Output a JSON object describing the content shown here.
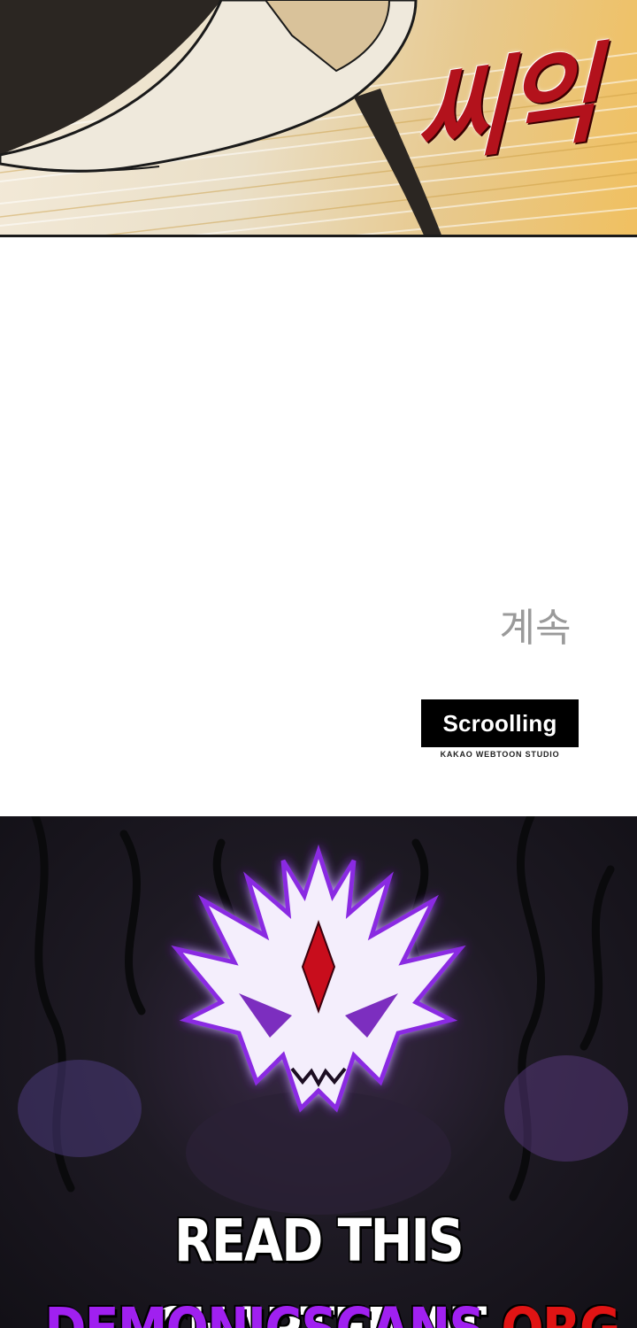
{
  "panel": {
    "sound_effect": "씨익"
  },
  "ending": {
    "to_be_continued": "계속",
    "studio_logo": "Scroolling",
    "studio_subtitle": "KAKAO WEBTOON STUDIO"
  },
  "promo": {
    "line1": "READ THIS CHAPTER AT",
    "site_name": "DEMONICSCANS",
    "site_tld": ".ORG",
    "emblem": "demon-mask-emblem",
    "colors": {
      "site_name": "#a020f0",
      "site_tld": "#e01414",
      "emblem_glow": "#8a2be2",
      "emblem_gem": "#c8101c"
    }
  }
}
